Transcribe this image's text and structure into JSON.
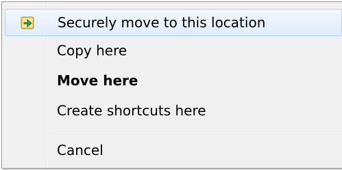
{
  "context_menu": {
    "items": [
      {
        "label": "Securely move to this location",
        "icon": "secure-move-icon",
        "highlighted": true,
        "bold": false
      },
      {
        "label": "Copy here",
        "bold": false
      },
      {
        "label": "Move here",
        "bold": true
      },
      {
        "label": "Create shortcuts here",
        "bold": false
      },
      {
        "label": "Cancel",
        "bold": false
      }
    ]
  },
  "colors": {
    "menu_background": "#f0f0f0",
    "highlight_border": "#aecff7",
    "highlight_fill": "#e1ecfb",
    "icon_green": "#3fa33a"
  }
}
